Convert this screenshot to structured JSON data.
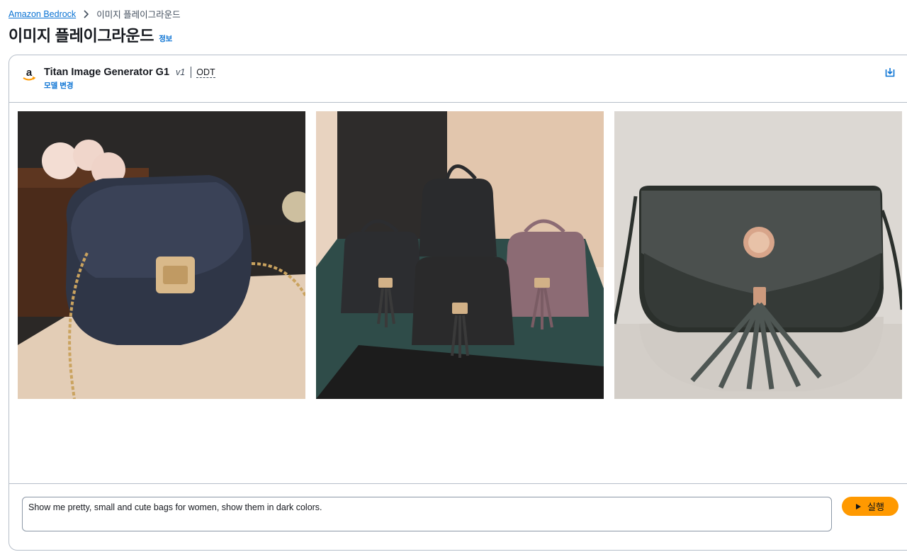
{
  "breadcrumb": {
    "root": "Amazon Bedrock",
    "current": "이미지 플레이그라운드"
  },
  "page": {
    "title": "이미지 플레이그라운드",
    "info_link": "정보"
  },
  "model": {
    "name": "Titan Image Generator G1",
    "version": "v1",
    "tag": "ODT",
    "change_link": "모델 변경"
  },
  "images": [
    {
      "icon": "generated-image-crossbody-bag"
    },
    {
      "icon": "generated-image-bag-collection"
    },
    {
      "icon": "generated-image-tassel-bag"
    }
  ],
  "prompt": {
    "value": "Show me pretty, small and cute bags for women, show them in dark colors."
  },
  "actions": {
    "run_label": "실행"
  },
  "colors": {
    "link": "#0972d3",
    "primary_button": "#ff9900",
    "border": "#b6bec9"
  }
}
